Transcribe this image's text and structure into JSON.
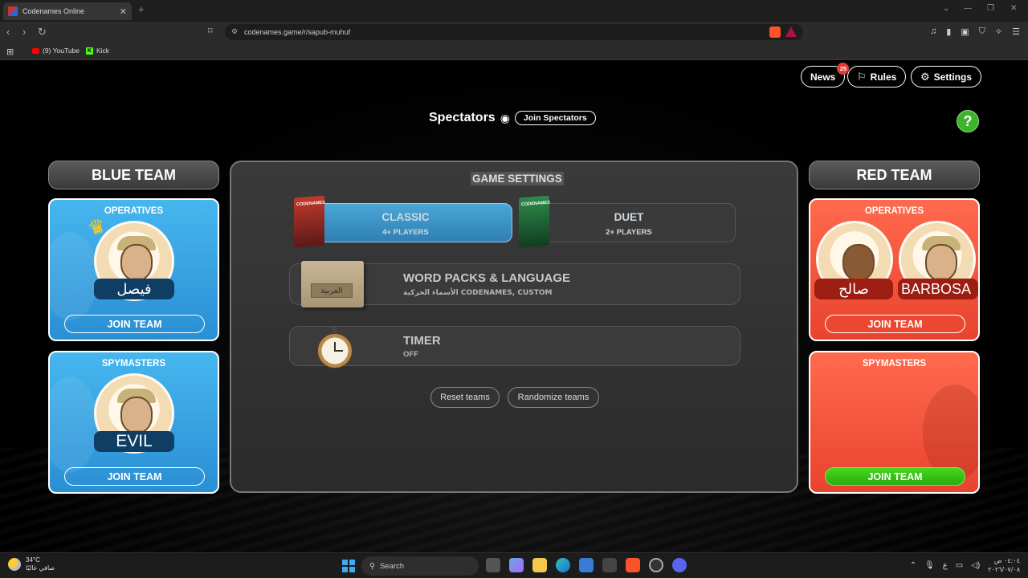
{
  "browser": {
    "tab_title": "Codenames Online",
    "url": "codenames.game/r/sapub-muhuf",
    "bookmarks": [
      {
        "label": "(9) YouTube"
      },
      {
        "label": "Kick"
      }
    ]
  },
  "header": {
    "news_label": "News",
    "news_count": "25",
    "rules_label": "Rules",
    "settings_label": "Settings",
    "help_label": "?"
  },
  "spectators": {
    "label": "Spectators",
    "join_label": "Join Spectators"
  },
  "blue_team": {
    "title": "BLUE TEAM",
    "operatives": {
      "title": "OPERATIVES",
      "players": [
        "فيصل"
      ],
      "join_label": "JOIN TEAM"
    },
    "spymasters": {
      "title": "SPYMASTERS",
      "players": [
        "EVIL"
      ],
      "join_label": "JOIN TEAM"
    }
  },
  "red_team": {
    "title": "RED TEAM",
    "operatives": {
      "title": "OPERATIVES",
      "players": [
        "صالح",
        "BARBOSA"
      ],
      "join_label": "JOIN TEAM"
    },
    "spymasters": {
      "title": "SPYMASTERS",
      "players": [],
      "join_label": "JOIN TEAM"
    }
  },
  "game_settings": {
    "title": "GAME SETTINGS",
    "modes": [
      {
        "name": "CLASSIC",
        "sub": "4+ PLAYERS",
        "box_text": "CODENAMES",
        "active": true
      },
      {
        "name": "DUET",
        "sub": "2+ PLAYERS",
        "box_text": "CODENAMES",
        "active": false
      }
    ],
    "word_packs": {
      "title": "WORD PACKS & LANGUAGE",
      "sub": "الأسماء الحركية CODENAMES, CUSTOM",
      "box_text": "العربية"
    },
    "timer": {
      "title": "TIMER",
      "sub": "OFF"
    },
    "reset_label": "Reset teams",
    "randomize_label": "Randomize teams"
  },
  "taskbar": {
    "temperature": "34°C",
    "weather_desc": "صافي غالبًا",
    "search_label": "Search",
    "lang": "ع",
    "time": "٠٤:٠٤ ص",
    "date": "٢٠٢٦/٠٧/٠٨"
  },
  "colors": {
    "blue_team": "#2a8fd4",
    "red_team": "#e8432e",
    "join_green": "#2caa10",
    "help_green": "#3cb32a"
  }
}
